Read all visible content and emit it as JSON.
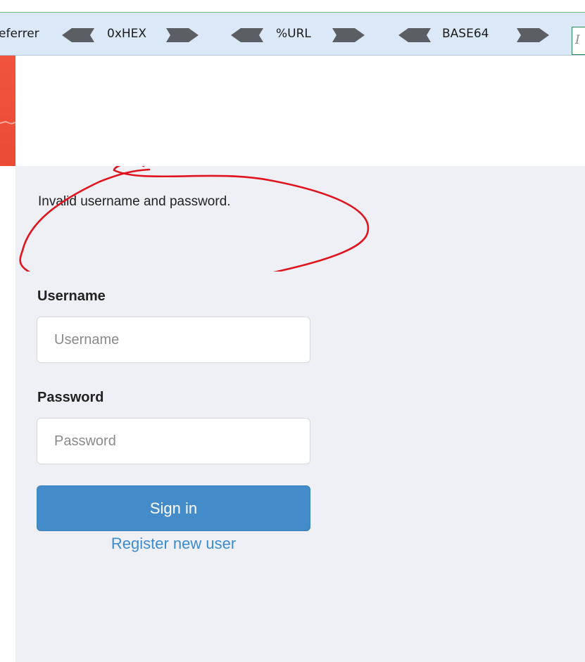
{
  "toolbar": {
    "referrer_label": "eferrer",
    "hex_label": "0xHEX",
    "url_label": "%URL",
    "base64_label": "BASE64",
    "input_value": "I"
  },
  "login": {
    "error_message": "Invalid username and password.",
    "username_label": "Username",
    "username_placeholder": "Username",
    "password_label": "Password",
    "password_placeholder": "Password",
    "signin_label": "Sign in",
    "register_label": "Register new user"
  },
  "colors": {
    "brand": "#ea4b35",
    "primary_button": "#438cc9",
    "link": "#3b8bd0",
    "content_bg": "#eff0f6",
    "toolbar_bg": "#dbe8f8",
    "annotation": "#e0141e"
  }
}
